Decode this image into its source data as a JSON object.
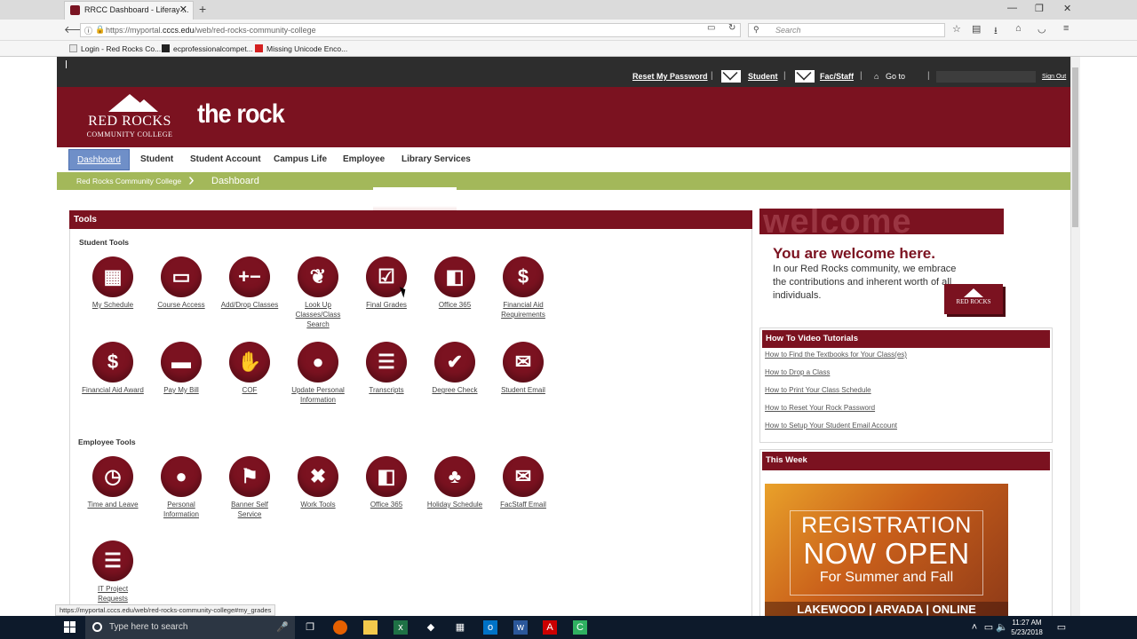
{
  "browser": {
    "tab_title": "RRCC Dashboard - Liferay ...",
    "url_prefix": "https://myportal.",
    "url_domain": "cccs.edu",
    "url_path": "/web/red-rocks-community-college",
    "search_placeholder": "Search",
    "bookmarks": [
      "Login - Red Rocks Co...",
      "ecprofessionalcompet...",
      "Missing Unicode Enco..."
    ]
  },
  "topbar": {
    "reset_password": "Reset My Password",
    "student": "Student",
    "facstaff": "Fac/Staff",
    "goto": "Go to",
    "signout": "Sign Out"
  },
  "header": {
    "logo_line1": "RED ROCKS",
    "logo_line2": "COMMUNITY COLLEGE",
    "brand": "the rock"
  },
  "nav": {
    "tabs": [
      "Dashboard",
      "Student",
      "Student Account",
      "Campus Life",
      "Employee",
      "Library Services"
    ]
  },
  "breadcrumb": {
    "root": "Red Rocks Community College",
    "current": "Dashboard"
  },
  "tools": {
    "title": "Tools",
    "student_title": "Student Tools",
    "student": [
      {
        "label": "My Schedule",
        "icon": "calendar-icon",
        "glyph": "▦"
      },
      {
        "label": "Course Access",
        "icon": "browser-window-icon",
        "glyph": "▭"
      },
      {
        "label": "Add/Drop Classes",
        "icon": "plus-minus-icon",
        "glyph": "+−"
      },
      {
        "label": "Look Up Classes/Class Search",
        "icon": "owl-icon",
        "glyph": "❦"
      },
      {
        "label": "Final Grades",
        "icon": "checklist-icon",
        "glyph": "☑"
      },
      {
        "label": "Office 365",
        "icon": "office-icon",
        "glyph": "◧"
      },
      {
        "label": "Financial Aid Requirements",
        "icon": "document-dollar-icon",
        "glyph": "$"
      },
      {
        "label": "Financial Aid Award",
        "icon": "dollar-icon",
        "glyph": "$"
      },
      {
        "label": "Pay My Bill",
        "icon": "credit-card-icon",
        "glyph": "▬"
      },
      {
        "label": "COF",
        "icon": "hand-money-icon",
        "glyph": "✋"
      },
      {
        "label": "Update Personal Information",
        "icon": "person-icon",
        "glyph": "●"
      },
      {
        "label": "Transcripts",
        "icon": "document-icon",
        "glyph": "☰"
      },
      {
        "label": "Degree Check",
        "icon": "certificate-check-icon",
        "glyph": "✔"
      },
      {
        "label": "Student Email",
        "icon": "envelope-icon",
        "glyph": "✉"
      }
    ],
    "employee_title": "Employee Tools",
    "employee": [
      {
        "label": "Time and Leave",
        "icon": "clock-person-icon",
        "glyph": "◷"
      },
      {
        "label": "Personal Information",
        "icon": "person-icon",
        "glyph": "●"
      },
      {
        "label": "Banner Self Service",
        "icon": "banner-icon",
        "glyph": "⚑"
      },
      {
        "label": "Work Tools",
        "icon": "tools-icon",
        "glyph": "✖"
      },
      {
        "label": "Office 365",
        "icon": "office-icon",
        "glyph": "◧"
      },
      {
        "label": "Holiday Schedule",
        "icon": "palm-tree-icon",
        "glyph": "♣"
      },
      {
        "label": "FacStaff Email",
        "icon": "envelope-icon",
        "glyph": "✉"
      },
      {
        "label": "IT Project Requests",
        "icon": "document-icon",
        "glyph": "☰"
      }
    ]
  },
  "welcome": {
    "banner": "welcome",
    "headline": "You are welcome here.",
    "text": "In our Red Rocks community, we embrace the contributions and inherent worth of all individuals.",
    "mini_logo": "RED ROCKS"
  },
  "videos": {
    "title": "How To Video Tutorials",
    "links": [
      "How to Find the Textbooks for Your Class(es)",
      "How to Drop a Class",
      "How to Print Your Class Schedule",
      "How to Reset Your Rock Password",
      "How to Setup Your Student Email Account"
    ]
  },
  "thisweek": {
    "title": "This Week",
    "line1": "REGISTRATION",
    "line2": "NOW OPEN",
    "line3": "For Summer and Fall",
    "line4": "LAKEWOOD | ARVADA | ONLINE"
  },
  "status_url": "https://myportal.cccs.edu/web/red-rocks-community-college#my_grades",
  "taskbar": {
    "search": "Type here to search",
    "time": "11:27 AM",
    "date": "5/23/2018"
  }
}
